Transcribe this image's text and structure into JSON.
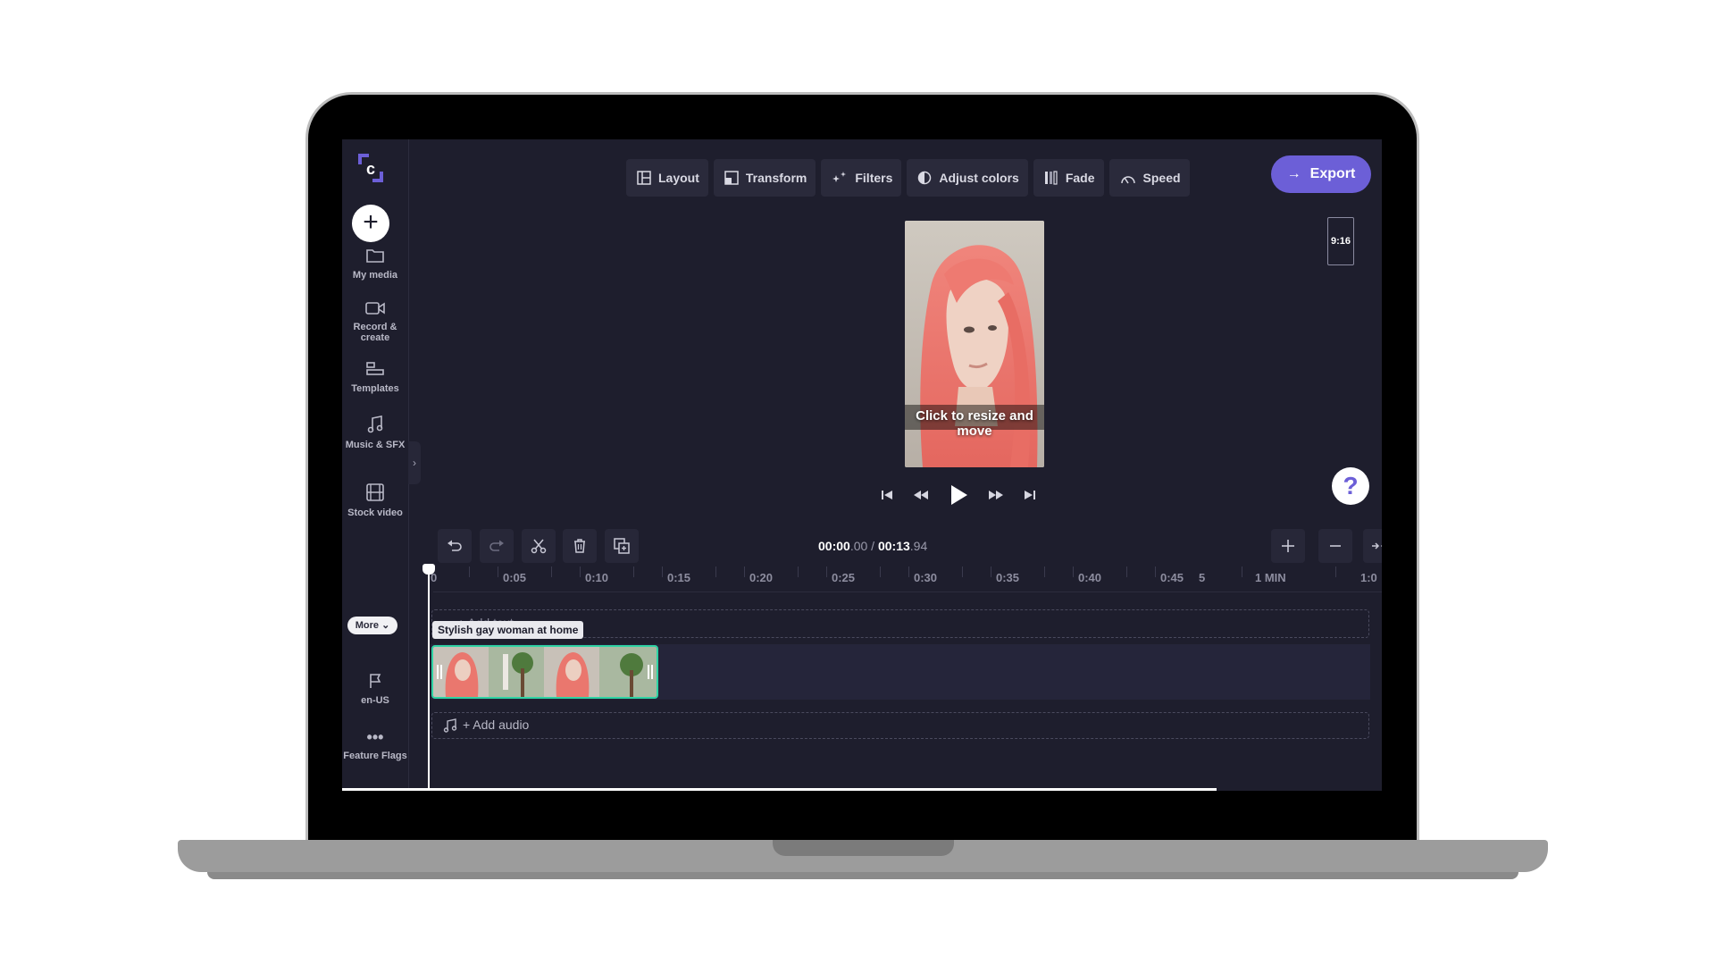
{
  "toolbar": {
    "layout": "Layout",
    "transform": "Transform",
    "filters": "Filters",
    "adjust_colors": "Adjust colors",
    "fade": "Fade",
    "speed": "Speed"
  },
  "export_label": "Export",
  "aspect_ratio": "9:16",
  "preview_hint": "Click to resize and move",
  "help_label": "?",
  "sidebar": {
    "items": [
      {
        "label": "My media",
        "icon": "folder-icon"
      },
      {
        "label": "Record & create",
        "icon": "camera-icon"
      },
      {
        "label": "Templates",
        "icon": "templates-icon"
      },
      {
        "label": "Music & SFX",
        "icon": "music-icon"
      },
      {
        "label": "Stock video",
        "icon": "film-icon"
      }
    ],
    "more": "More",
    "locale": "en-US",
    "feature_flags": "Feature Flags"
  },
  "timecode": {
    "current_main": "00:00",
    "current_frac": ".00",
    "separator": " / ",
    "total_main": "00:13",
    "total_frac": ".94"
  },
  "ruler": {
    "labels": [
      "0",
      "0:05",
      "0:10",
      "0:15",
      "0:20",
      "0:25",
      "0:30",
      "0:35",
      "0:40",
      "0:45",
      "5",
      "1 MIN",
      "1:0"
    ]
  },
  "tracks": {
    "text_placeholder": "+ Add text",
    "clip_name": "Stylish gay woman at home",
    "audio_placeholder": "+ Add audio"
  },
  "colors": {
    "accent": "#6c5fd7",
    "clip_border": "#2fd3a4",
    "background": "#1e1e2d"
  }
}
